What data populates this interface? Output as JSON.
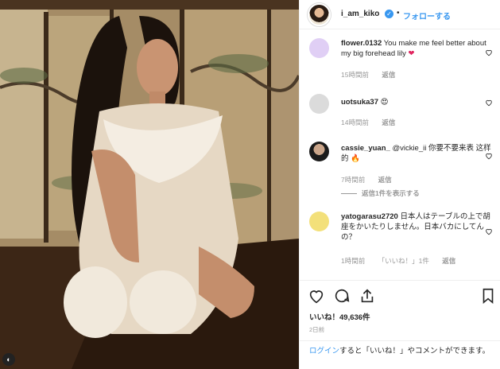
{
  "header": {
    "username": "i_am_kiko",
    "verified_glyph": "✓",
    "dot": "•",
    "follow_label": "フォローする"
  },
  "comments": [
    {
      "user": "flower.0132",
      "text": "You make me feel better about my big forehead lily",
      "emoji": "❤",
      "time": "15時間前",
      "reply": "返信"
    },
    {
      "user": "uotsuka37",
      "text": "",
      "emoji": "😍",
      "time": "14時間前",
      "reply": "返信"
    },
    {
      "user": "cassie_yuan_",
      "text": "@vickie_ii 你要不要来表 这样的",
      "emoji": "🔥",
      "time": "7時間前",
      "reply": "返信"
    },
    {
      "user": "yatogarasu2720",
      "text": "日本人はテーブルの上で胡座をかいたりしません。日本バカにしてんの？",
      "emoji": "",
      "time": "1時間前",
      "likes": "「いいね！」1件",
      "reply": "返信"
    }
  ],
  "view_replies": "返信1件を表示する",
  "actions": {
    "likes": "いいね！49,636件",
    "date": "2日前"
  },
  "login_bar": {
    "login": "ログイン",
    "rest": "すると「いいね！」やコメントができます。"
  },
  "colors": {
    "link": "#3897f0",
    "muted": "#999999",
    "border": "#efefef"
  },
  "icons": [
    "heart-icon",
    "comment-icon",
    "share-icon",
    "bookmark-icon"
  ]
}
